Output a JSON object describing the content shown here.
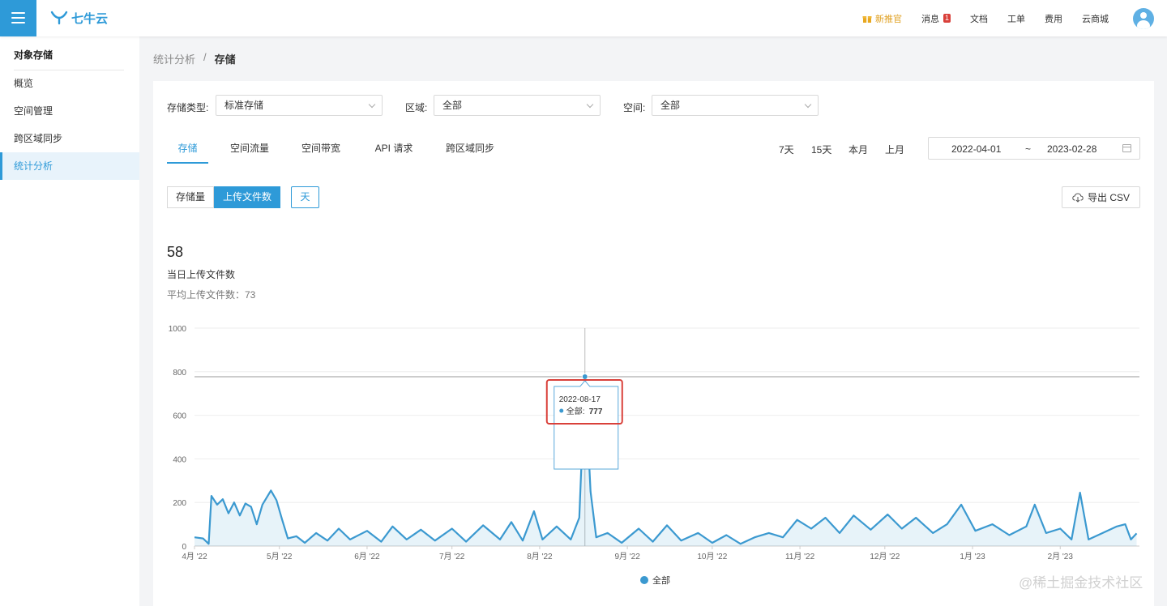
{
  "topbar": {
    "logo_text": "七牛云",
    "nav": [
      {
        "label": "新推官",
        "highlight": true
      },
      {
        "label": "消息",
        "badge": "1"
      },
      {
        "label": "文档"
      },
      {
        "label": "工单"
      },
      {
        "label": "费用"
      },
      {
        "label": "云商城"
      }
    ]
  },
  "sidebar": {
    "title": "对象存储",
    "items": [
      {
        "label": "概览"
      },
      {
        "label": "空间管理"
      },
      {
        "label": "跨区域同步"
      },
      {
        "label": "统计分析",
        "active": true
      }
    ]
  },
  "breadcrumb": {
    "parent": "统计分析",
    "sep": "/",
    "current": "存储"
  },
  "filters": {
    "type_label": "存储类型:",
    "type_value": "标准存储",
    "region_label": "区域:",
    "region_value": "全部",
    "space_label": "空间:",
    "space_value": "全部"
  },
  "tabs": [
    "存储",
    "空间流量",
    "空间带宽",
    "API 请求",
    "跨区域同步"
  ],
  "quick_ranges": [
    "7天",
    "15天",
    "本月",
    "上月"
  ],
  "date_range": {
    "start": "2022-04-01",
    "sep": "~",
    "end": "2023-02-28"
  },
  "metric_toggle": {
    "storage_label": "存储量",
    "files_label": "上传文件数"
  },
  "granularity_label": "天",
  "export_label": "导出 CSV",
  "stat": {
    "value": "58",
    "label": "当日上传文件数",
    "avg_text": "平均上传文件数：73"
  },
  "colors": {
    "accent": "#2e9ad8",
    "series": "#3b99d0",
    "highlight_box": "#d9403a"
  },
  "chart_data": {
    "type": "area",
    "y_ticks": [
      "1000",
      "800",
      "600",
      "400",
      "200",
      "0"
    ],
    "ylim": [
      0,
      1000
    ],
    "x_tick_labels": [
      "4月 '22",
      "5月 '22",
      "6月 '22",
      "7月 '22",
      "8月 '22",
      "9月 '22",
      "10月 '22",
      "11月 '22",
      "12月 '22",
      "1月 '23",
      "2月 '23"
    ],
    "legend": "全部",
    "series": [
      {
        "name": "全部",
        "points": [
          [
            "2022-04-01",
            40
          ],
          [
            "2022-04-04",
            35
          ],
          [
            "2022-04-06",
            10
          ],
          [
            "2022-04-07",
            230
          ],
          [
            "2022-04-09",
            190
          ],
          [
            "2022-04-11",
            215
          ],
          [
            "2022-04-13",
            150
          ],
          [
            "2022-04-15",
            200
          ],
          [
            "2022-04-17",
            140
          ],
          [
            "2022-04-19",
            195
          ],
          [
            "2022-04-21",
            180
          ],
          [
            "2022-04-23",
            100
          ],
          [
            "2022-04-25",
            190
          ],
          [
            "2022-04-28",
            255
          ],
          [
            "2022-04-30",
            210
          ],
          [
            "2022-05-02",
            120
          ],
          [
            "2022-05-04",
            35
          ],
          [
            "2022-05-07",
            45
          ],
          [
            "2022-05-10",
            15
          ],
          [
            "2022-05-14",
            60
          ],
          [
            "2022-05-18",
            25
          ],
          [
            "2022-05-22",
            80
          ],
          [
            "2022-05-26",
            30
          ],
          [
            "2022-06-01",
            70
          ],
          [
            "2022-06-06",
            20
          ],
          [
            "2022-06-10",
            90
          ],
          [
            "2022-06-15",
            30
          ],
          [
            "2022-06-20",
            75
          ],
          [
            "2022-06-25",
            25
          ],
          [
            "2022-07-01",
            80
          ],
          [
            "2022-07-06",
            20
          ],
          [
            "2022-07-12",
            95
          ],
          [
            "2022-07-18",
            30
          ],
          [
            "2022-07-22",
            110
          ],
          [
            "2022-07-26",
            25
          ],
          [
            "2022-07-30",
            160
          ],
          [
            "2022-08-02",
            30
          ],
          [
            "2022-08-07",
            90
          ],
          [
            "2022-08-12",
            30
          ],
          [
            "2022-08-15",
            130
          ],
          [
            "2022-08-17",
            777
          ],
          [
            "2022-08-19",
            250
          ],
          [
            "2022-08-21",
            40
          ],
          [
            "2022-08-25",
            60
          ],
          [
            "2022-08-30",
            15
          ],
          [
            "2022-09-05",
            80
          ],
          [
            "2022-09-10",
            20
          ],
          [
            "2022-09-15",
            95
          ],
          [
            "2022-09-20",
            25
          ],
          [
            "2022-09-26",
            60
          ],
          [
            "2022-10-01",
            15
          ],
          [
            "2022-10-06",
            50
          ],
          [
            "2022-10-11",
            10
          ],
          [
            "2022-10-16",
            40
          ],
          [
            "2022-10-21",
            60
          ],
          [
            "2022-10-26",
            40
          ],
          [
            "2022-10-31",
            120
          ],
          [
            "2022-11-05",
            80
          ],
          [
            "2022-11-10",
            130
          ],
          [
            "2022-11-15",
            60
          ],
          [
            "2022-11-20",
            140
          ],
          [
            "2022-11-26",
            75
          ],
          [
            "2022-12-02",
            145
          ],
          [
            "2022-12-07",
            80
          ],
          [
            "2022-12-12",
            130
          ],
          [
            "2022-12-18",
            60
          ],
          [
            "2022-12-23",
            100
          ],
          [
            "2022-12-28",
            190
          ],
          [
            "2023-01-02",
            70
          ],
          [
            "2023-01-08",
            100
          ],
          [
            "2023-01-14",
            50
          ],
          [
            "2023-01-20",
            90
          ],
          [
            "2023-01-23",
            190
          ],
          [
            "2023-01-27",
            60
          ],
          [
            "2023-02-01",
            80
          ],
          [
            "2023-02-05",
            30
          ],
          [
            "2023-02-08",
            245
          ],
          [
            "2023-02-11",
            30
          ],
          [
            "2023-02-16",
            60
          ],
          [
            "2023-02-21",
            90
          ],
          [
            "2023-02-24",
            100
          ],
          [
            "2023-02-26",
            30
          ],
          [
            "2023-02-28",
            58
          ]
        ]
      }
    ],
    "tooltip": {
      "date": "2022-08-17",
      "series_label": "全部:",
      "value": "777"
    }
  }
}
